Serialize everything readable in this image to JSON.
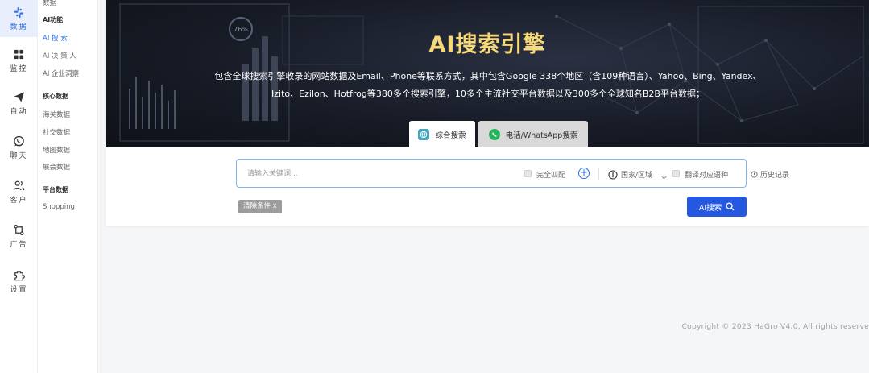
{
  "rail": {
    "items": [
      {
        "label": "数据",
        "icon": "slack-grid-icon"
      },
      {
        "label": "监控",
        "icon": "grid-icon"
      },
      {
        "label": "自动",
        "icon": "paper-plane-icon"
      },
      {
        "label": "聊天",
        "icon": "whatsapp-icon"
      },
      {
        "label": "客户",
        "icon": "users-icon"
      },
      {
        "label": "广告",
        "icon": "git-compare-icon"
      },
      {
        "label": "设置",
        "icon": "puzzle-icon"
      }
    ]
  },
  "submenu": {
    "top_item": "数据",
    "sections": [
      {
        "title": "AI功能",
        "items": [
          "AI 搜 索",
          "AI 决 策 人",
          "AI 企业洞察"
        ]
      },
      {
        "title": "核心数据",
        "items": [
          "海关数据",
          "社交数据",
          "地图数据",
          "展会数据"
        ]
      },
      {
        "title": "平台数据",
        "items": [
          "Shopping"
        ]
      }
    ]
  },
  "hero": {
    "title": "AI搜索引擎",
    "desc_line1": "包含全球搜索引擎收录的网站数据及Email、Phone等联系方式，其中包含Google 338个地区（含109种语言）、Yahoo、Bing、Yandex、",
    "desc_line2": "Izito、Ezilon、Hotfrog等380多个搜索引擎，10多个主流社交平台数据以及300多个全球知名B2B平台数据；",
    "chart_label": "76%"
  },
  "tabs": {
    "active": "综合搜索",
    "inactive": "电话/WhatsApp搜索"
  },
  "search": {
    "placeholder": "请输入关键词...",
    "exact_match": "完全匹配",
    "country_region": "国家/区域",
    "translate": "翻译对应语种",
    "history": "历史记录",
    "clear_filter": "清除条件 x",
    "ai_search": "AI搜索"
  },
  "colors": {
    "accent": "#2458e0",
    "hero_title": "#f5d97a",
    "active_nav": "#2f6fe4"
  },
  "footer": "Copyright © 2023 HaGro V4.0, All rights reserve"
}
